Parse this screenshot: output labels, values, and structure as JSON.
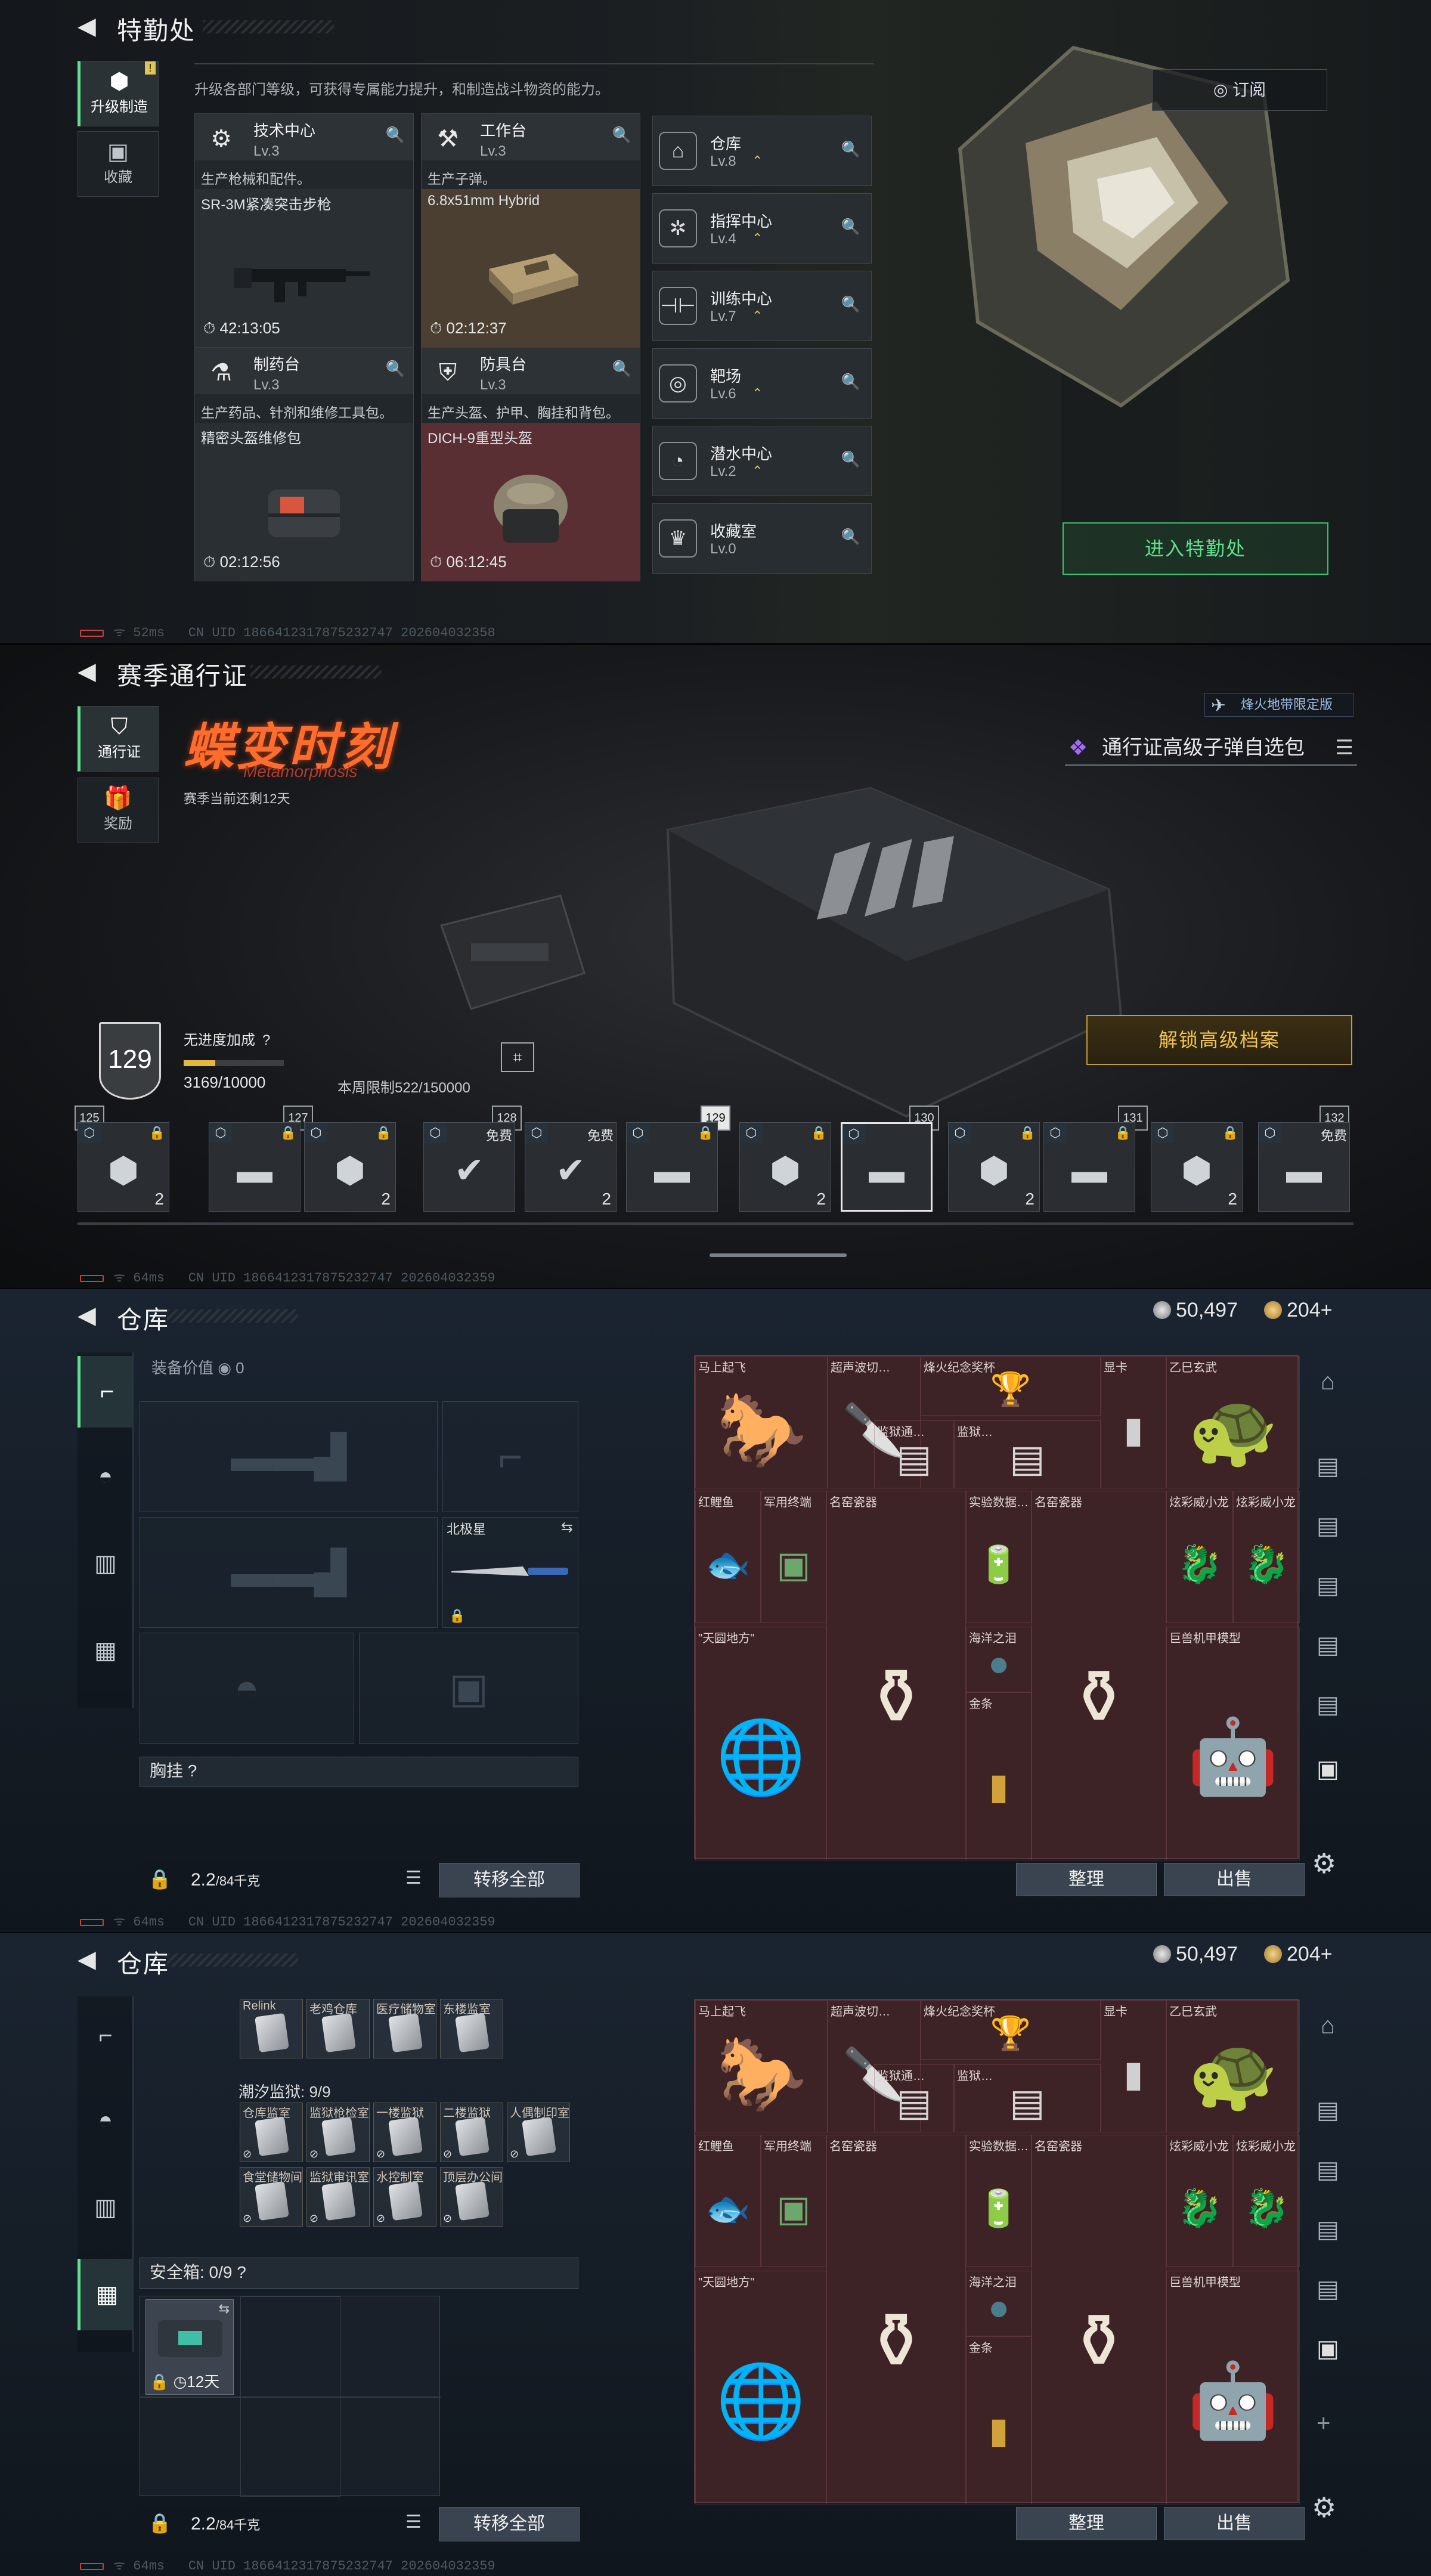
{
  "panel1": {
    "title": "特勤处",
    "tabs": [
      {
        "label": "升级制造",
        "icon": "upgrade-icon"
      },
      {
        "label": "收藏",
        "icon": "collection-icon"
      }
    ],
    "badge": "!",
    "description": "升级各部门等级，可获得专属能力提升，和制造战斗物资的能力。",
    "subscribe": "订阅",
    "cards": [
      {
        "name": "技术中心",
        "level": "Lv.3",
        "desc": "生产枪械和配件。",
        "item": "SR-3M紧凑突击步枪",
        "time": "42:13:05",
        "bg": "#2a2f33"
      },
      {
        "name": "工作台",
        "level": "Lv.3",
        "desc": "生产子弹。",
        "item": "6.8x51mm Hybrid",
        "time": "02:12:37",
        "bg": "#4a3f31"
      },
      {
        "name": "制药台",
        "level": "Lv.3",
        "desc": "生产药品、针剂和维修工具包。",
        "item": "精密头盔维修包",
        "time": "02:12:56",
        "bg": "#2a2f33"
      },
      {
        "name": "防具台",
        "level": "Lv.3",
        "desc": "生产头盔、护甲、胸挂和背包。",
        "item": "DICH-9重型头盔",
        "time": "06:12:45",
        "bg": "#5a2f34"
      }
    ],
    "facilities": [
      {
        "name": "仓库",
        "level": "Lv.8"
      },
      {
        "name": "指挥中心",
        "level": "Lv.4"
      },
      {
        "name": "训练中心",
        "level": "Lv.7"
      },
      {
        "name": "靶场",
        "level": "Lv.6"
      },
      {
        "name": "潜水中心",
        "level": "Lv.2"
      },
      {
        "name": "收藏室",
        "level": "Lv.0"
      }
    ],
    "enter_button": "进入特勤处",
    "ping": "52ms",
    "uid": "CN UID 1866412317875232747 202604032358"
  },
  "panel2": {
    "title": "赛季通行证",
    "tabs": [
      {
        "label": "通行证"
      },
      {
        "label": "奖励"
      }
    ],
    "logo": "蝶变时刻",
    "logo_sub": "Metamorphosis",
    "season_left": "赛季当前还剩12天",
    "limited": "烽火地带限定版",
    "pack": "通行证高级子弹自选包",
    "level": "129",
    "bonus": "无进度加成",
    "xp": "3169/10000",
    "xp_fraction": 0.3169,
    "weekly": "本周限制522/150000",
    "unlock": "解锁高级档案",
    "levels": [
      "125",
      "127",
      "128",
      "129",
      "130",
      "131",
      "132"
    ],
    "rewards": [
      {
        "lock": "🔒",
        "count": "2",
        "type": "crate"
      },
      {
        "lock": "🔒",
        "count": "",
        "type": "case"
      },
      {
        "lock": "🔒",
        "count": "2",
        "type": "crate"
      },
      {
        "free": "免费",
        "count": "",
        "type": "check"
      },
      {
        "free": "免费",
        "count": "2",
        "type": "check"
      },
      {
        "lock": "🔒",
        "count": "",
        "type": "case"
      },
      {
        "lock": "🔒",
        "count": "2",
        "type": "crate"
      },
      {
        "lock": "",
        "count": "",
        "type": "case"
      },
      {
        "lock": "🔒",
        "count": "2",
        "type": "crate"
      },
      {
        "lock": "🔒",
        "count": "",
        "type": "case"
      },
      {
        "lock": "🔒",
        "count": "2",
        "type": "crate"
      },
      {
        "free": "免费",
        "count": "",
        "type": "case"
      }
    ],
    "ping": "64ms",
    "uid": "CN UID 1866412317875232747 202604032359"
  },
  "warehouse": {
    "title": "仓库",
    "money": "50,497",
    "bonds": "204+",
    "equip_value_label": "装备价值",
    "equip_value": "0",
    "secondary_label": "北极星",
    "chest_rig": "胸挂",
    "weight": "2.2",
    "weight_max": "/84千克",
    "transfer_all": "转移全部",
    "sort": "整理",
    "sell": "出售",
    "stash_items": [
      {
        "name": "马上起飞",
        "icon": "🐎",
        "color": "#c65a36"
      },
      {
        "name": "超声波切…",
        "icon": "🔪",
        "color": "#d5d5d5"
      },
      {
        "name": "烽火纪念奖杯",
        "icon": "🏆",
        "color": "#d8b76c"
      },
      {
        "name": "显卡",
        "icon": "▮",
        "color": "#d0d0d0"
      },
      {
        "name": "乙巳玄武",
        "icon": "🐢",
        "color": "#e0b43a"
      },
      {
        "name": "监狱通…",
        "icon": "▤",
        "color": "#d6d6d6"
      },
      {
        "name": "监狱…",
        "icon": "▤",
        "color": "#d6d6d6"
      },
      {
        "name": "红鲤鱼",
        "icon": "🐟",
        "color": "#e46a4a"
      },
      {
        "name": "军用终端",
        "icon": "▣",
        "color": "#6ca86c"
      },
      {
        "name": "名窑瓷器",
        "icon": "⚱",
        "color": "#ede6d6"
      },
      {
        "name": "实验数据…",
        "icon": "🔋",
        "color": "#c9c9c9"
      },
      {
        "name": "名窑瓷器",
        "icon": "⚱",
        "color": "#ede6d6"
      },
      {
        "name": "炫彩威小龙",
        "icon": "🐉",
        "color": "#d9d2dc"
      },
      {
        "name": "炫彩威小龙",
        "icon": "🐉",
        "color": "#d9d2dc"
      },
      {
        "name": "海洋之泪",
        "icon": "●",
        "color": "#4a7e8c"
      },
      {
        "name": "\"天圆地方\"",
        "icon": "🌐",
        "color": "#c9a042"
      },
      {
        "name": "金条",
        "icon": "▮",
        "color": "#d1a23a"
      },
      {
        "name": "巨兽机甲模型",
        "icon": "🤖",
        "color": "#9aa0a6"
      }
    ],
    "ping": "64ms",
    "uid1": "CN UID 1866412317875232747 202604032359",
    "uid2": "CN UID 1866412317875232747 202604032359"
  },
  "panel4": {
    "keys": [
      {
        "name": "Relink"
      },
      {
        "name": "老鸡仓库"
      },
      {
        "name": "医疗储物室"
      },
      {
        "name": "东楼监室"
      }
    ],
    "prison_label": "潮汐监狱: 9/9",
    "keys2": [
      {
        "name": "仓库监室"
      },
      {
        "name": "监狱枪检室"
      },
      {
        "name": "一楼监狱"
      },
      {
        "name": "二楼监狱"
      },
      {
        "name": "人偶制印室"
      },
      {
        "name": "食堂储物间"
      },
      {
        "name": "监狱审讯室"
      },
      {
        "name": "水控制室"
      },
      {
        "name": "顶层办公间"
      }
    ],
    "safebox": "安全箱: 0/9",
    "safe_days": "12天"
  }
}
